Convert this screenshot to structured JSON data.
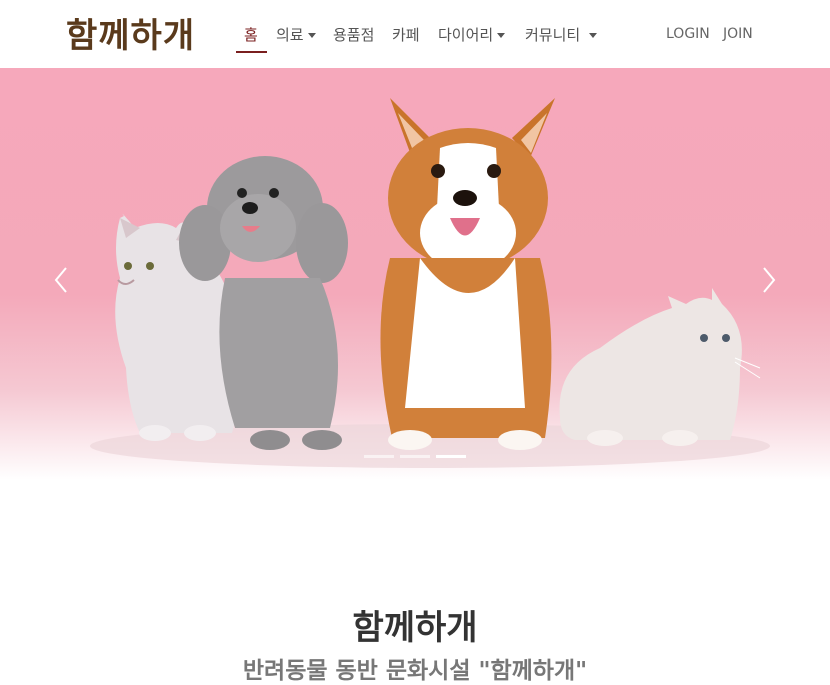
{
  "brand": {
    "logo_text": "함께하개",
    "accent_color": "#7a1f1f"
  },
  "nav": {
    "items": [
      {
        "label": "홈",
        "active": true,
        "dropdown": false
      },
      {
        "label": "의료",
        "active": false,
        "dropdown": true
      },
      {
        "label": "용품점",
        "active": false,
        "dropdown": false
      },
      {
        "label": "카페",
        "active": false,
        "dropdown": false
      },
      {
        "label": "다이어리",
        "active": false,
        "dropdown": true
      },
      {
        "label": "커뮤니티",
        "active": false,
        "dropdown": true
      }
    ],
    "login_label": "LOGIN",
    "join_label": "JOIN"
  },
  "carousel": {
    "slide_description_icon": "pets-photo",
    "slide_count": 3,
    "active_slide": 3,
    "background_color": "#f4a9ba"
  },
  "hero": {
    "title": "함께하개",
    "subtitle": "반려동물 동반 문화시설 \"함께하개\""
  }
}
